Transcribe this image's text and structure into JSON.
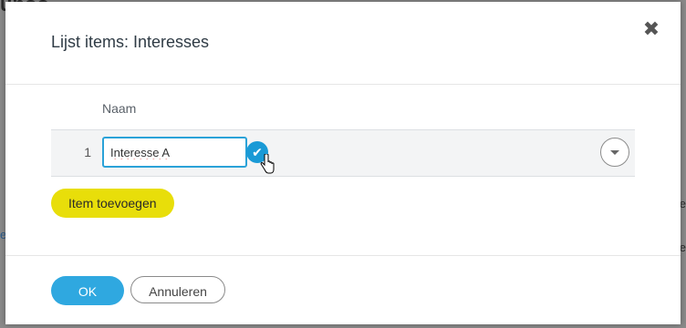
{
  "background": {
    "title_fragment": "unoo",
    "left_fragment": "e",
    "right_fragment_1": "e",
    "right_fragment_2": "e"
  },
  "modal": {
    "title": "Lijst items: Interesses",
    "close_icon": "close-icon"
  },
  "grid": {
    "columns": [
      "Naam"
    ],
    "rows": [
      {
        "number": "1",
        "name_value": "Interesse A"
      }
    ]
  },
  "actions": {
    "add_item_label": "Item toevoegen",
    "ok_label": "OK",
    "cancel_label": "Annuleren"
  },
  "colors": {
    "accent_blue": "#2fa8e0",
    "add_yellow": "#e8de0a",
    "input_focus": "#2aa2d8"
  }
}
